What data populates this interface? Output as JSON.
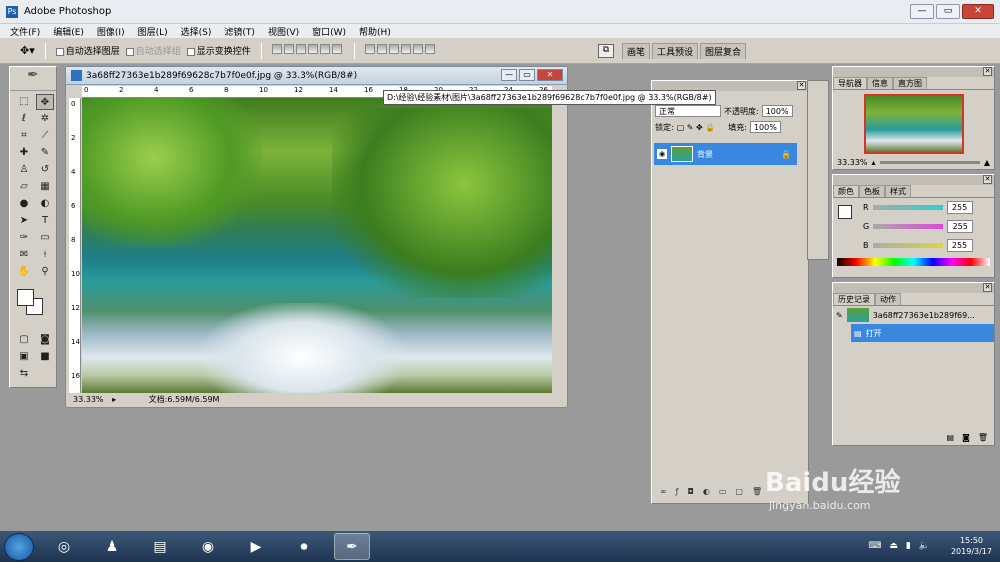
{
  "app": {
    "title": "Adobe Photoshop",
    "logo_text": "Ps"
  },
  "window_controls": {
    "minimize": "—",
    "restore": "▭",
    "close": "✕"
  },
  "menu": [
    "文件(F)",
    "编辑(E)",
    "图像(I)",
    "图层(L)",
    "选择(S)",
    "滤镜(T)",
    "视图(V)",
    "窗口(W)",
    "帮助(H)"
  ],
  "options": {
    "auto_select_layer": "自动选择图层",
    "auto_select_group": "自动选择组",
    "show_transform": "显示变换控件",
    "panel_tabs": [
      "画笔",
      "工具预设",
      "图层复合"
    ]
  },
  "document": {
    "title": "3a68ff27363e1b289f69628c7b7f0e0f.jpg @ 33.3%(RGB/8#)",
    "zoom": "33.33%",
    "doc_size": "文档:6.59M/6.59M",
    "tooltip": "D:\\经验\\经验素材\\图片\\3a68ff27363e1b289f69628c7b7f0e0f.jpg @ 33.3%(RGB/8#)",
    "hruler": [
      "0",
      "2",
      "4",
      "6",
      "8",
      "10",
      "12",
      "14",
      "16",
      "18",
      "20",
      "22",
      "24",
      "26"
    ],
    "vruler": [
      "0",
      "2",
      "4",
      "6",
      "8",
      "10",
      "12",
      "14",
      "16"
    ]
  },
  "layers": {
    "blend_mode": "正常",
    "opacity_label": "不透明度:",
    "opacity": "100%",
    "lock_label": "锁定:",
    "fill_label": "填充:",
    "fill": "100%",
    "items": [
      {
        "name": "背景",
        "visible": true,
        "locked": true
      }
    ]
  },
  "navigator": {
    "tabs": [
      "导航器",
      "信息",
      "直方图"
    ],
    "zoom": "33.33%"
  },
  "color": {
    "tabs": [
      "颜色",
      "色板",
      "样式"
    ],
    "channels": [
      {
        "label": "R",
        "value": "255",
        "color": "#2ccfcf"
      },
      {
        "label": "G",
        "value": "255",
        "color": "#d94ad9"
      },
      {
        "label": "B",
        "value": "255",
        "color": "#d9d93a"
      }
    ]
  },
  "history": {
    "tabs": [
      "历史记录",
      "动作"
    ],
    "snapshot": "3a68ff27363e1b289f69...",
    "steps": [
      "打开"
    ]
  },
  "taskbar": {
    "time": "15:50",
    "date": "2019/3/17"
  },
  "watermark": {
    "brand": "Baidu经验",
    "url": "jingyan.baidu.com"
  }
}
